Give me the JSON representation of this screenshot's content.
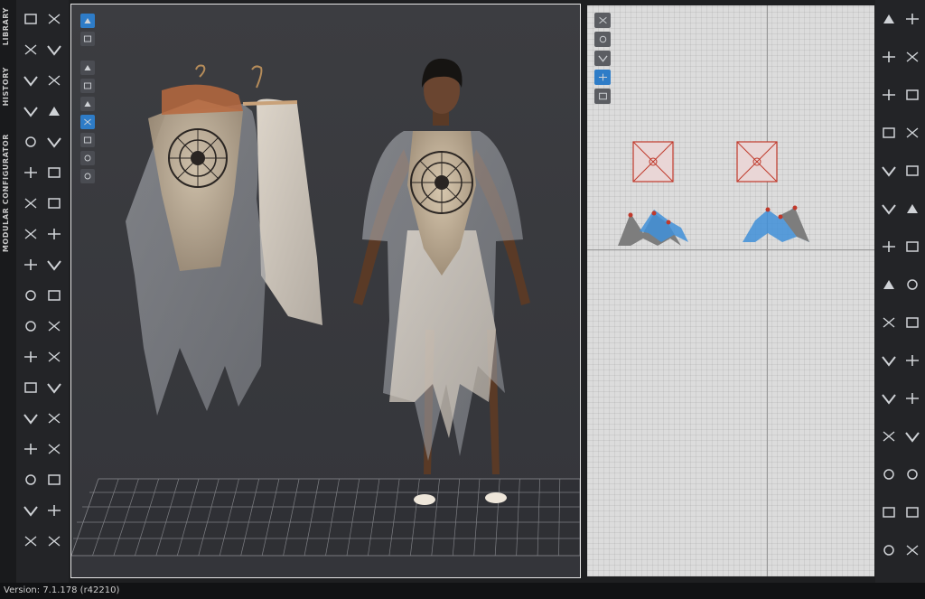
{
  "side_tabs": [
    "LIBRARY",
    "HISTORY",
    "MODULAR CONFIGURATOR"
  ],
  "left_toolbar_icons": [
    "arrow-down-icon",
    "walk-icon",
    "move-icon",
    "move-ring-icon",
    "transform-icon",
    "fold-icon",
    "shirt-icon",
    "tack-icon",
    "sewing-machine-icon",
    "brush-icon",
    "avatar-measure-icon",
    "pins-icon",
    "hanger-icon",
    "button-icon",
    "fabric-icon",
    "pattern-icon",
    "puzzle-icon",
    "zipper-icon",
    "sewing-icon",
    "strap-icon",
    "hat-icon",
    "shape-icon",
    "tshirt-icon",
    "glove-icon",
    "ruler-icon",
    "pocket-icon",
    "sleeve-icon",
    "belt-icon",
    "arm-icon",
    "hand-icon",
    "shoe-icon",
    "sock-icon",
    "iron-icon",
    "graphic-icon",
    "knife-icon",
    "needle-icon"
  ],
  "right_toolbar_icons": [
    "select-triangle-icon",
    "undo-icon",
    "line-icon",
    "segment-icon",
    "rect-icon",
    "rect-curve-icon",
    "internal-line-icon",
    "dart-icon",
    "circle-icon",
    "square-dots-icon",
    "bound-icon",
    "curve-icon",
    "notch-icon",
    "seam-icon",
    "trace-icon",
    "piping-icon",
    "grade-icon",
    "buttonhole-icon",
    "fold-arrange-icon",
    "smooth-icon",
    "length-icon",
    "equal-icon",
    "segment-sew-icon",
    "zigzag-icon",
    "text-icon",
    "text-size-icon",
    "grid-icon",
    "puckering-icon",
    "fabric-grain-icon",
    "avatar-pose-icon"
  ],
  "viewport3d_tools": [
    "cube-view-icon",
    "garment-view-icon",
    "shirt-display-icon",
    "avatar-display-icon",
    "person-icon",
    "fabric-texture-icon",
    "thickness-icon",
    "skin-icon",
    "globe-icon"
  ],
  "viewport2d_tools": [
    "brush-select-icon",
    "garment-2d-icon",
    "info-icon",
    "fabric-2d-icon",
    "tag-icon"
  ],
  "status": {
    "version": "Version: 7.1.178 (r42210)"
  },
  "colors": {
    "viewport3d_bg": "#3b3c40",
    "viewport2d_bg": "#dcdcdc",
    "pattern_selected": "#3f8fd8",
    "pattern_gray": "#7d7d7d",
    "pin_red": "#c0392b"
  }
}
